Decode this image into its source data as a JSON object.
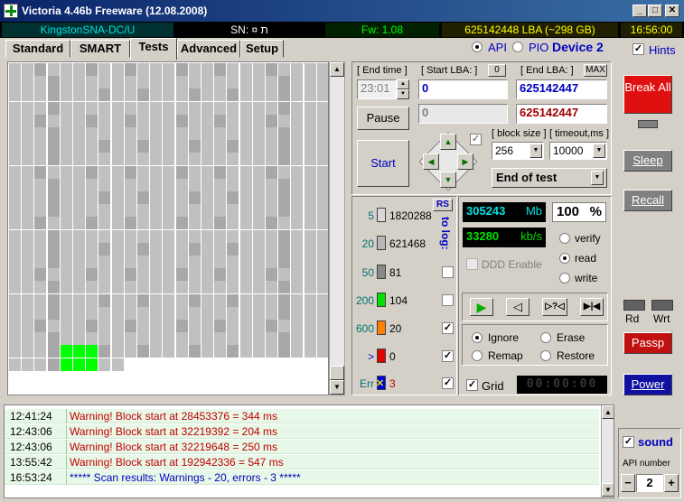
{
  "window": {
    "title": "Victoria 4.46b Freeware (12.08.2008)",
    "min": "_",
    "max": "□",
    "close": "✕"
  },
  "infobar": {
    "model": "KingstonSNA-DC/U",
    "serial": "SN: ¤                      ת",
    "firmware": "Fw: 1.08",
    "lba": "625142448 LBA (~298 GB)",
    "clock": "16:56:00"
  },
  "tabs": [
    "Standard",
    "SMART",
    "Tests",
    "Advanced",
    "Setup"
  ],
  "mode": {
    "api_label": "API",
    "pio_label": "PIO",
    "device": "Device 2",
    "hints_label": "Hints"
  },
  "tests": {
    "end_time_label": "[ End time ]",
    "end_time_value": "23:01",
    "start_lba_label": "[ Start LBA: ]",
    "start_lba_zero": "0",
    "start_lba_value": "0",
    "end_lba_label": "[ End LBA: ]",
    "end_lba_max": "MAX",
    "end_lba_value": "625142447",
    "current_lba_value": "0",
    "current_end_value": "625142447",
    "pause_label": "Pause",
    "start_label": "Start",
    "block_size_label": "[ block size ]",
    "block_size_value": "256",
    "timeout_label": "[ timeout,ms ]",
    "timeout_value": "10000",
    "end_action_value": "End of test"
  },
  "stats": {
    "rs_label": "RS",
    "to_log_label": "to log:",
    "rows": [
      {
        "label": "5",
        "count": "1820288",
        "color": "#d8d8d8"
      },
      {
        "label": "20",
        "count": "621468",
        "color": "#b8b8b8"
      },
      {
        "label": "50",
        "count": "81",
        "color": "#888888"
      },
      {
        "label": "200",
        "count": "104",
        "color": "#00e000"
      },
      {
        "label": "600",
        "count": "20",
        "color": "#ff8000"
      },
      {
        "label": ">",
        "count": "0",
        "color": "#e00000"
      },
      {
        "label": "Err",
        "count": "3",
        "color": "#0000e0"
      }
    ],
    "err_mark": "✕"
  },
  "speed": {
    "mb_value": "305243",
    "mb_unit": "Mb",
    "percent_value": "100",
    "percent_unit": "%",
    "kbs_value": "33280",
    "kbs_unit": "kb/s",
    "ddd_label": "DDD Enable",
    "verify_label": "verify",
    "read_label": "read",
    "write_label": "write",
    "ignore_label": "Ignore",
    "erase_label": "Erase",
    "remap_label": "Remap",
    "restore_label": "Restore",
    "grid_label": "Grid",
    "timer_value": "00:00:00"
  },
  "side": {
    "break_label": "Break All",
    "sleep_label": "Sleep",
    "recall_label": "Recall",
    "rd_label": "Rd",
    "wrt_label": "Wrt",
    "passp_label": "Passp",
    "power_label": "Power",
    "sound_label": "sound",
    "api_number_label": "API number",
    "api_number_value": "2",
    "minus": "−",
    "plus": "+"
  },
  "log": [
    {
      "time": "12:41:24",
      "msg": "Warning! Block start at 28453376 = 344 ms",
      "kind": "warn"
    },
    {
      "time": "12:43:06",
      "msg": "Warning! Block start at 32219392 = 204 ms",
      "kind": "warn"
    },
    {
      "time": "12:43:06",
      "msg": "Warning! Block start at 32219648 = 250 ms",
      "kind": "warn"
    },
    {
      "time": "13:55:42",
      "msg": "Warning! Block start at 192942336 = 547 ms",
      "kind": "warn"
    },
    {
      "time": "16:53:24",
      "msg": "***** Scan results: Warnings - 20, errors - 3 *****",
      "kind": "info"
    }
  ],
  "colors": {
    "grid_block": "#c0c0c0",
    "grid_block_dark": "#a8a8a8",
    "grid_block_green": "#00ff00",
    "break_red": "#e01010",
    "passp_red": "#c01010",
    "power_blue": "#1010a0"
  }
}
